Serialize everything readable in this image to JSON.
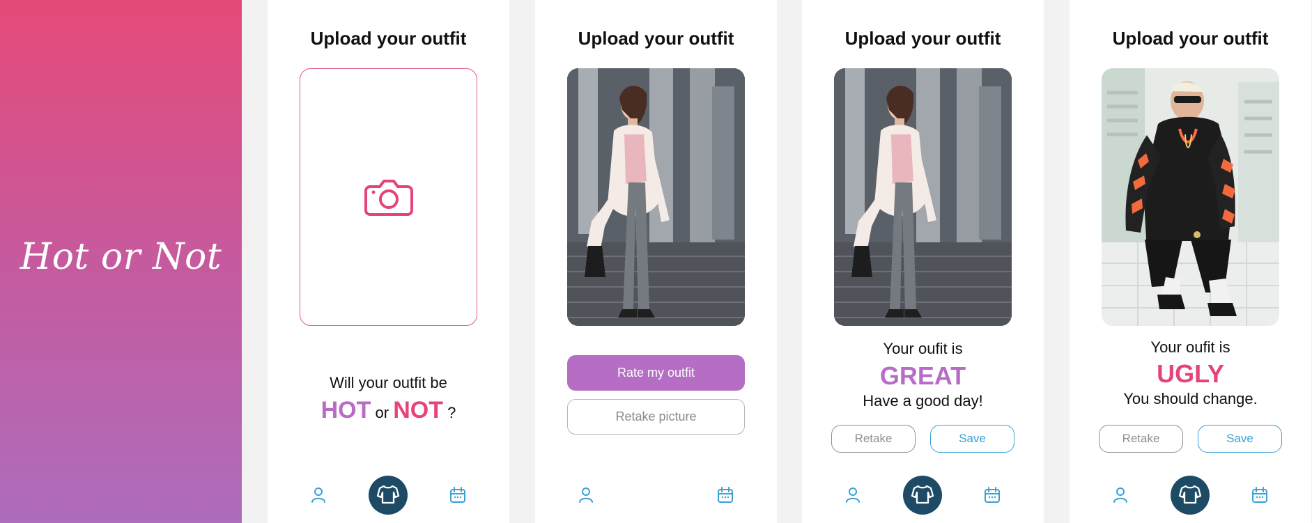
{
  "splash": {
    "brand": "Hot or Not",
    "gradient_top": "#e54a78",
    "gradient_bottom": "#ae6cbc"
  },
  "screens": [
    {
      "title": "Upload your outfit",
      "placeholder_icon": "camera-icon",
      "question_line1": "Will your outfit be",
      "question_hot": "HOT",
      "question_or": "or",
      "question_not": "NOT",
      "question_mark": "?",
      "nav": {
        "left_icon": "profile-icon",
        "center_icon": "sweater-icon",
        "right_icon": "calendar-icon"
      }
    },
    {
      "title": "Upload your outfit",
      "photo": "woman-coat-photo",
      "primary_button": "Rate my outfit",
      "secondary_button": "Retake picture",
      "nav": {
        "left_icon": "profile-icon",
        "right_icon": "calendar-icon"
      }
    },
    {
      "title": "Upload your outfit",
      "photo": "woman-coat-photo",
      "result_line1": "Your oufit is",
      "result_word": "GREAT",
      "result_line3": "Have a good day!",
      "buttons": {
        "retake": "Retake",
        "save": "Save"
      },
      "nav": {
        "left_icon": "profile-icon",
        "center_icon": "sweater-icon",
        "right_icon": "calendar-icon"
      }
    },
    {
      "title": "Upload your outfit",
      "photo": "man-hoodie-photo",
      "result_line1": "Your oufit is",
      "result_word": "UGLY",
      "result_line3": "You should change.",
      "buttons": {
        "retake": "Retake",
        "save": "Save"
      },
      "nav": {
        "left_icon": "profile-icon",
        "center_icon": "sweater-icon",
        "right_icon": "calendar-icon"
      }
    }
  ],
  "colors": {
    "accent_pink": "#e5437a",
    "accent_purple": "#b56ec3",
    "great": "#b86cc6",
    "ugly": "#e5437a",
    "blue": "#3aa0d6",
    "nav_center": "#1d4a65"
  }
}
